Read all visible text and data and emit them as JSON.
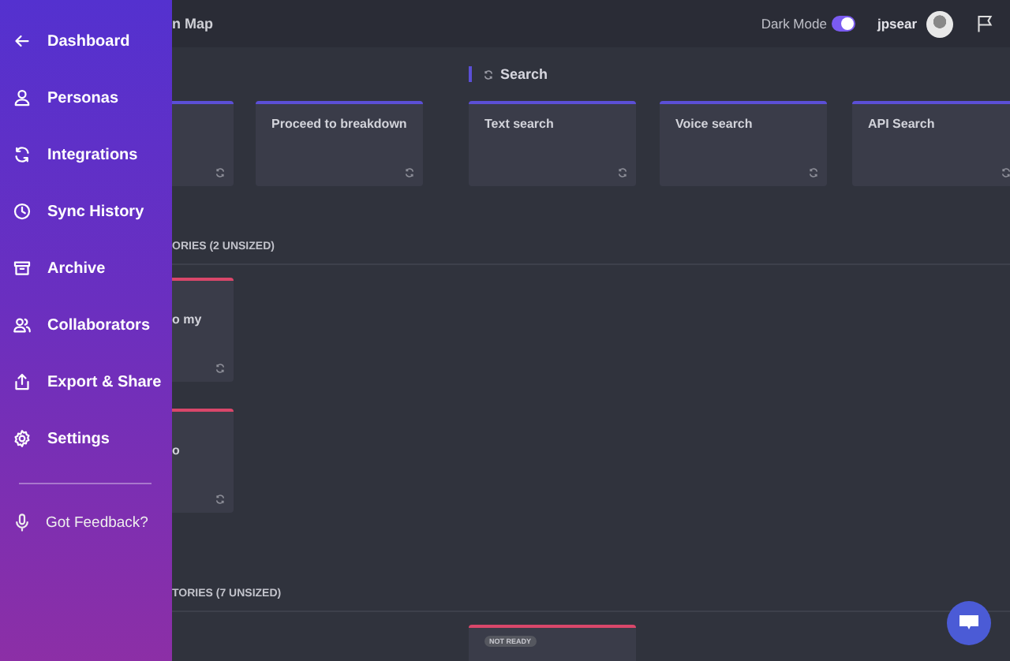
{
  "drawer": {
    "items": [
      {
        "label": "Dashboard"
      },
      {
        "label": "Personas"
      },
      {
        "label": "Integrations"
      },
      {
        "label": "Sync History"
      },
      {
        "label": "Archive"
      },
      {
        "label": "Collaborators"
      },
      {
        "label": "Export & Share"
      },
      {
        "label": "Settings"
      }
    ],
    "feedback": "Got Feedback?"
  },
  "top_bar": {
    "title": "n Map",
    "dark_mode": {
      "label": "Dark Mode",
      "on": true
    },
    "user": "jpsear"
  },
  "board": {
    "group_header": "Search",
    "feature_cards": [
      {
        "kind": "partial"
      },
      {
        "title": "Proceed to breakdown"
      },
      {
        "title": "Text search"
      },
      {
        "title": "Voice search"
      },
      {
        "title": "API Search"
      }
    ],
    "sections": [
      {
        "label": "ORIES (2 UNSIZED)",
        "cards": [
          {
            "text": "o my"
          },
          {
            "text": "o"
          }
        ]
      },
      {
        "label": "TORIES (7 UNSIZED)",
        "cards": [
          {
            "badge": "NOT READY"
          }
        ]
      }
    ]
  }
}
